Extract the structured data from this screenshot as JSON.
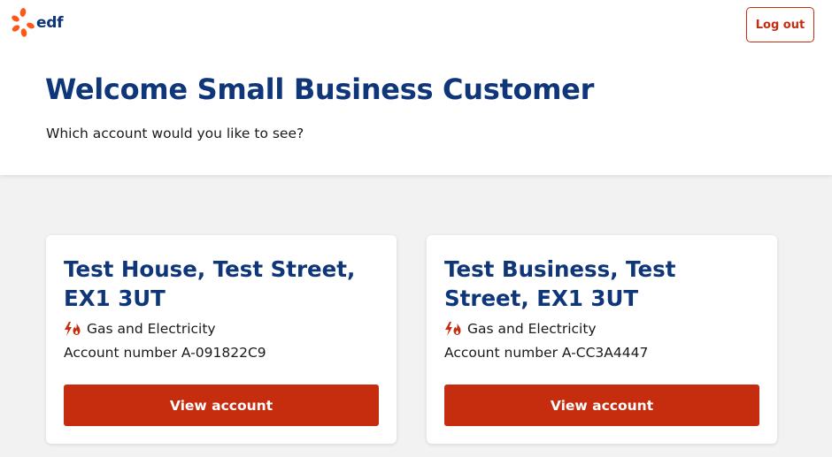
{
  "header": {
    "logo_text": "edf",
    "logout_label": "Log out"
  },
  "hero": {
    "title": "Welcome Small Business Customer",
    "subtitle": "Which account would you like to see?"
  },
  "accounts": [
    {
      "address": "Test House, Test Street, EX1 3UT",
      "fuel_type": "Gas and Electricity",
      "fuel_icon": "gas-electricity-icon",
      "account_number": "Account number A-091822C9",
      "button_label": "View account"
    },
    {
      "address": "Test Business, Test Street, EX1 3UT",
      "fuel_type": "Gas and Electricity",
      "fuel_icon": "gas-electricity-icon",
      "account_number": "Account number A-CC3A4447",
      "button_label": "View account"
    }
  ],
  "colors": {
    "brand_blue": "#10367a",
    "brand_orange": "#fe5716",
    "button_red": "#c62d0f",
    "page_bg": "#f2f2f2"
  }
}
